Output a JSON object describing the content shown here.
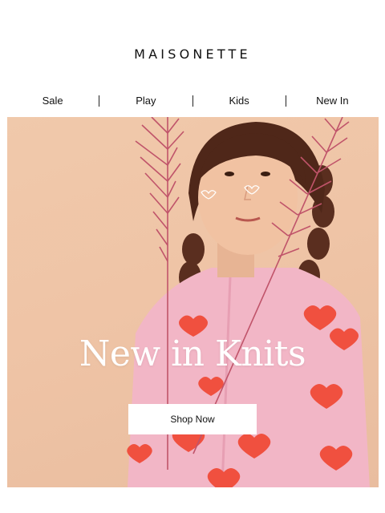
{
  "brand": {
    "logo_text": "MAISONETTE"
  },
  "nav": {
    "items": [
      {
        "label": "Sale"
      },
      {
        "label": "Play"
      },
      {
        "label": "Kids"
      },
      {
        "label": "New In"
      }
    ]
  },
  "hero": {
    "headline": "New in Knits",
    "cta_label": "Shop Now",
    "background_color": "#efc4a6",
    "sweater_color": "#f2b6c6",
    "heart_color": "#f0503f"
  }
}
